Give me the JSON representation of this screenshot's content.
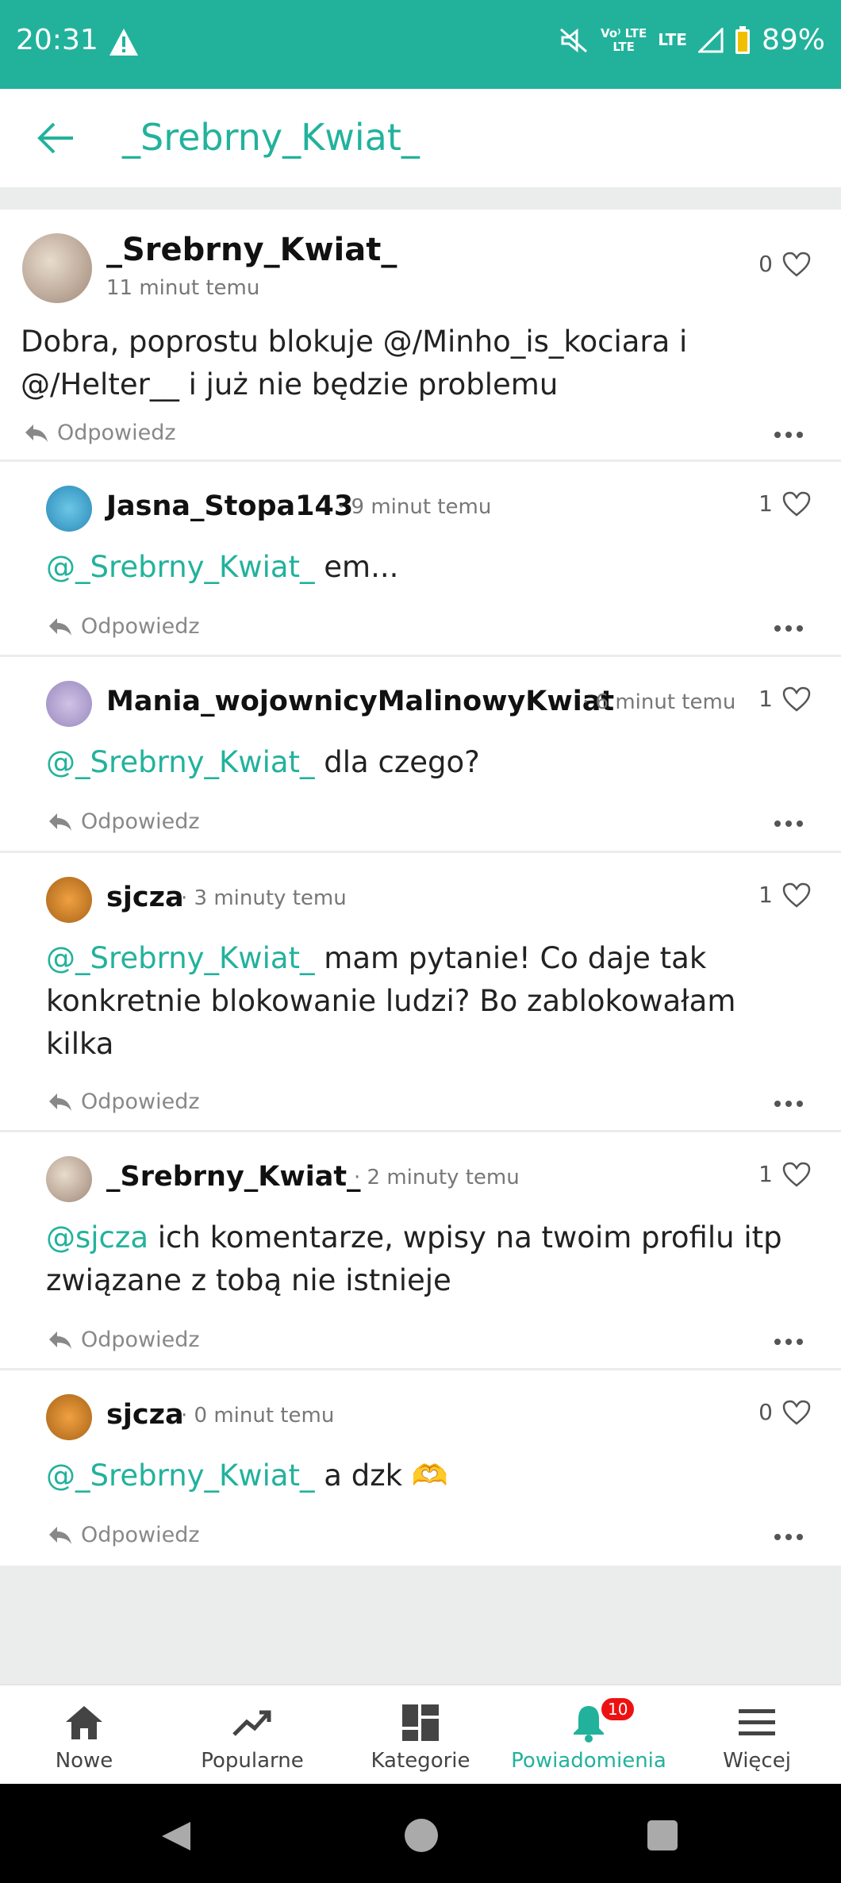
{
  "status_bar": {
    "time": "20:31",
    "network_top": "Vo⁾ LTE",
    "network_bottom": "LTE",
    "lte": "LTE",
    "battery": "89%"
  },
  "header": {
    "title": "_Srebrny_Kwiat_"
  },
  "comments": [
    {
      "user": "_Srebrny_Kwiat_",
      "time": "11 minut temu",
      "likes": "0",
      "text": "Dobra, poprostu blokuje @/Minho_is_kociara i @/Helter__ i już nie będzie problemu",
      "reply": "Odpowiedz"
    },
    {
      "user": "Jasna_Stopa143",
      "time": "· 9 minut temu",
      "likes": "1",
      "mention": "@_Srebrny_Kwiat_",
      "text": " em...",
      "reply": "Odpowiedz"
    },
    {
      "user": "Mania_wojownicyMalinowyKwiat",
      "time": "· 6 minut temu",
      "likes": "1",
      "mention": "@_Srebrny_Kwiat_",
      "text": " dla czego?",
      "reply": "Odpowiedz"
    },
    {
      "user": "sjcza",
      "time": "· 3 minuty temu",
      "likes": "1",
      "mention": "@_Srebrny_Kwiat_",
      "text": " mam pytanie! Co daje tak konkretnie blokowanie ludzi? Bo zablokowałam kilka",
      "reply": "Odpowiedz"
    },
    {
      "user": "_Srebrny_Kwiat_",
      "time": "· 2 minuty temu",
      "likes": "1",
      "mention": "@sjcza",
      "text": " ich komentarze, wpisy na twoim profilu itp związane z tobą nie istnieje",
      "reply": "Odpowiedz"
    },
    {
      "user": "sjcza",
      "time": "· 0 minut temu",
      "likes": "0",
      "mention": "@_Srebrny_Kwiat_",
      "text": " a dzk ",
      "emoji": "🫶",
      "reply": "Odpowiedz"
    }
  ],
  "bottom_nav": [
    {
      "label": "Nowe",
      "icon": "home-icon"
    },
    {
      "label": "Popularne",
      "icon": "trending-icon"
    },
    {
      "label": "Kategorie",
      "icon": "grid-icon"
    },
    {
      "label": "Powiadomienia",
      "icon": "bell-icon",
      "badge": "10",
      "active": true
    },
    {
      "label": "Więcej",
      "icon": "menu-icon"
    }
  ],
  "colors": {
    "accent": "#22b29c",
    "badge": "#e11111"
  }
}
